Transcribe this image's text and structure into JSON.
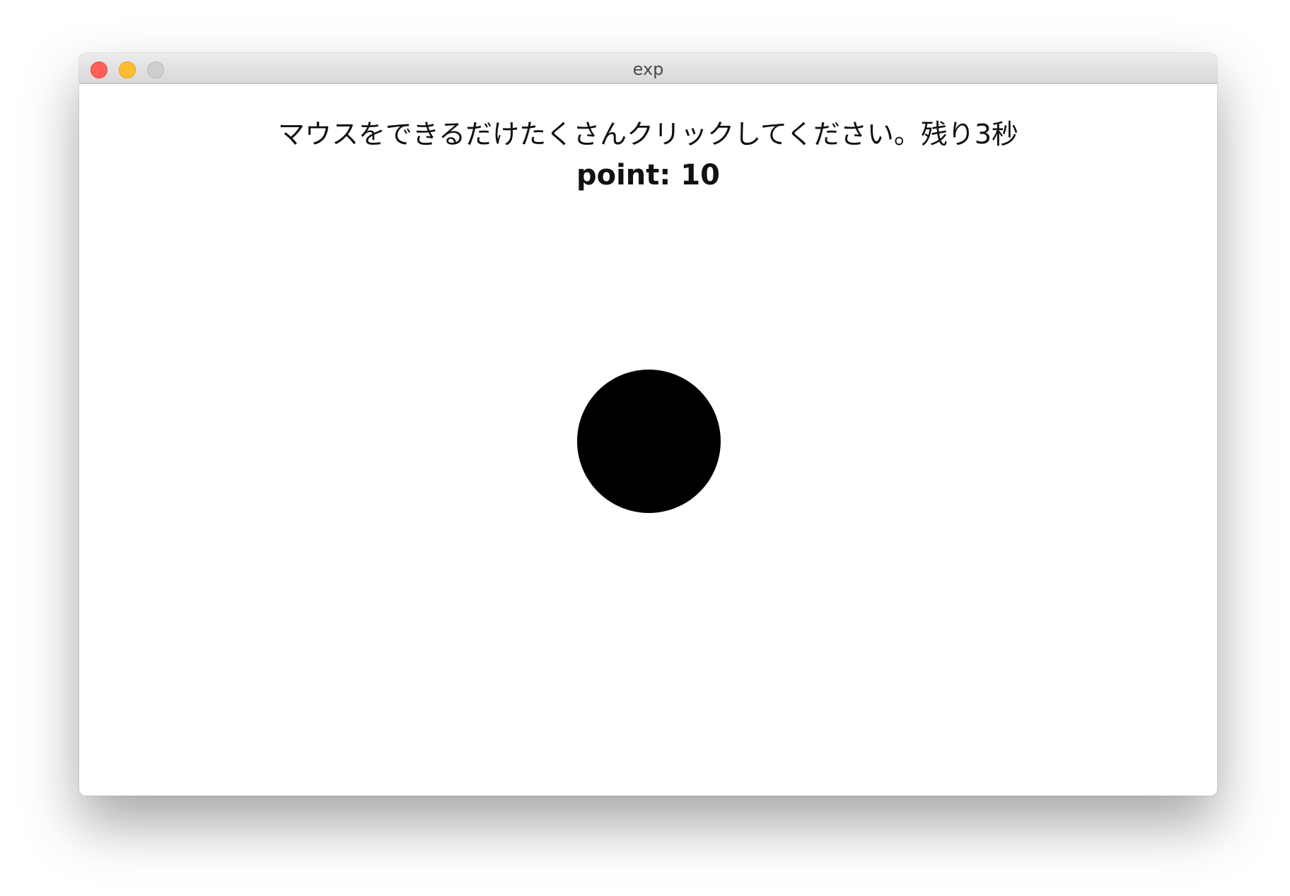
{
  "window": {
    "title": "exp"
  },
  "game": {
    "instruction": "マウスをできるだけたくさんクリックしてください。残り3秒",
    "point_label": "point:",
    "point_value": "10"
  },
  "colors": {
    "close": "#fe5f57",
    "minimize": "#febc2e",
    "zoom": "#cfcfcf",
    "target": "#000000"
  }
}
